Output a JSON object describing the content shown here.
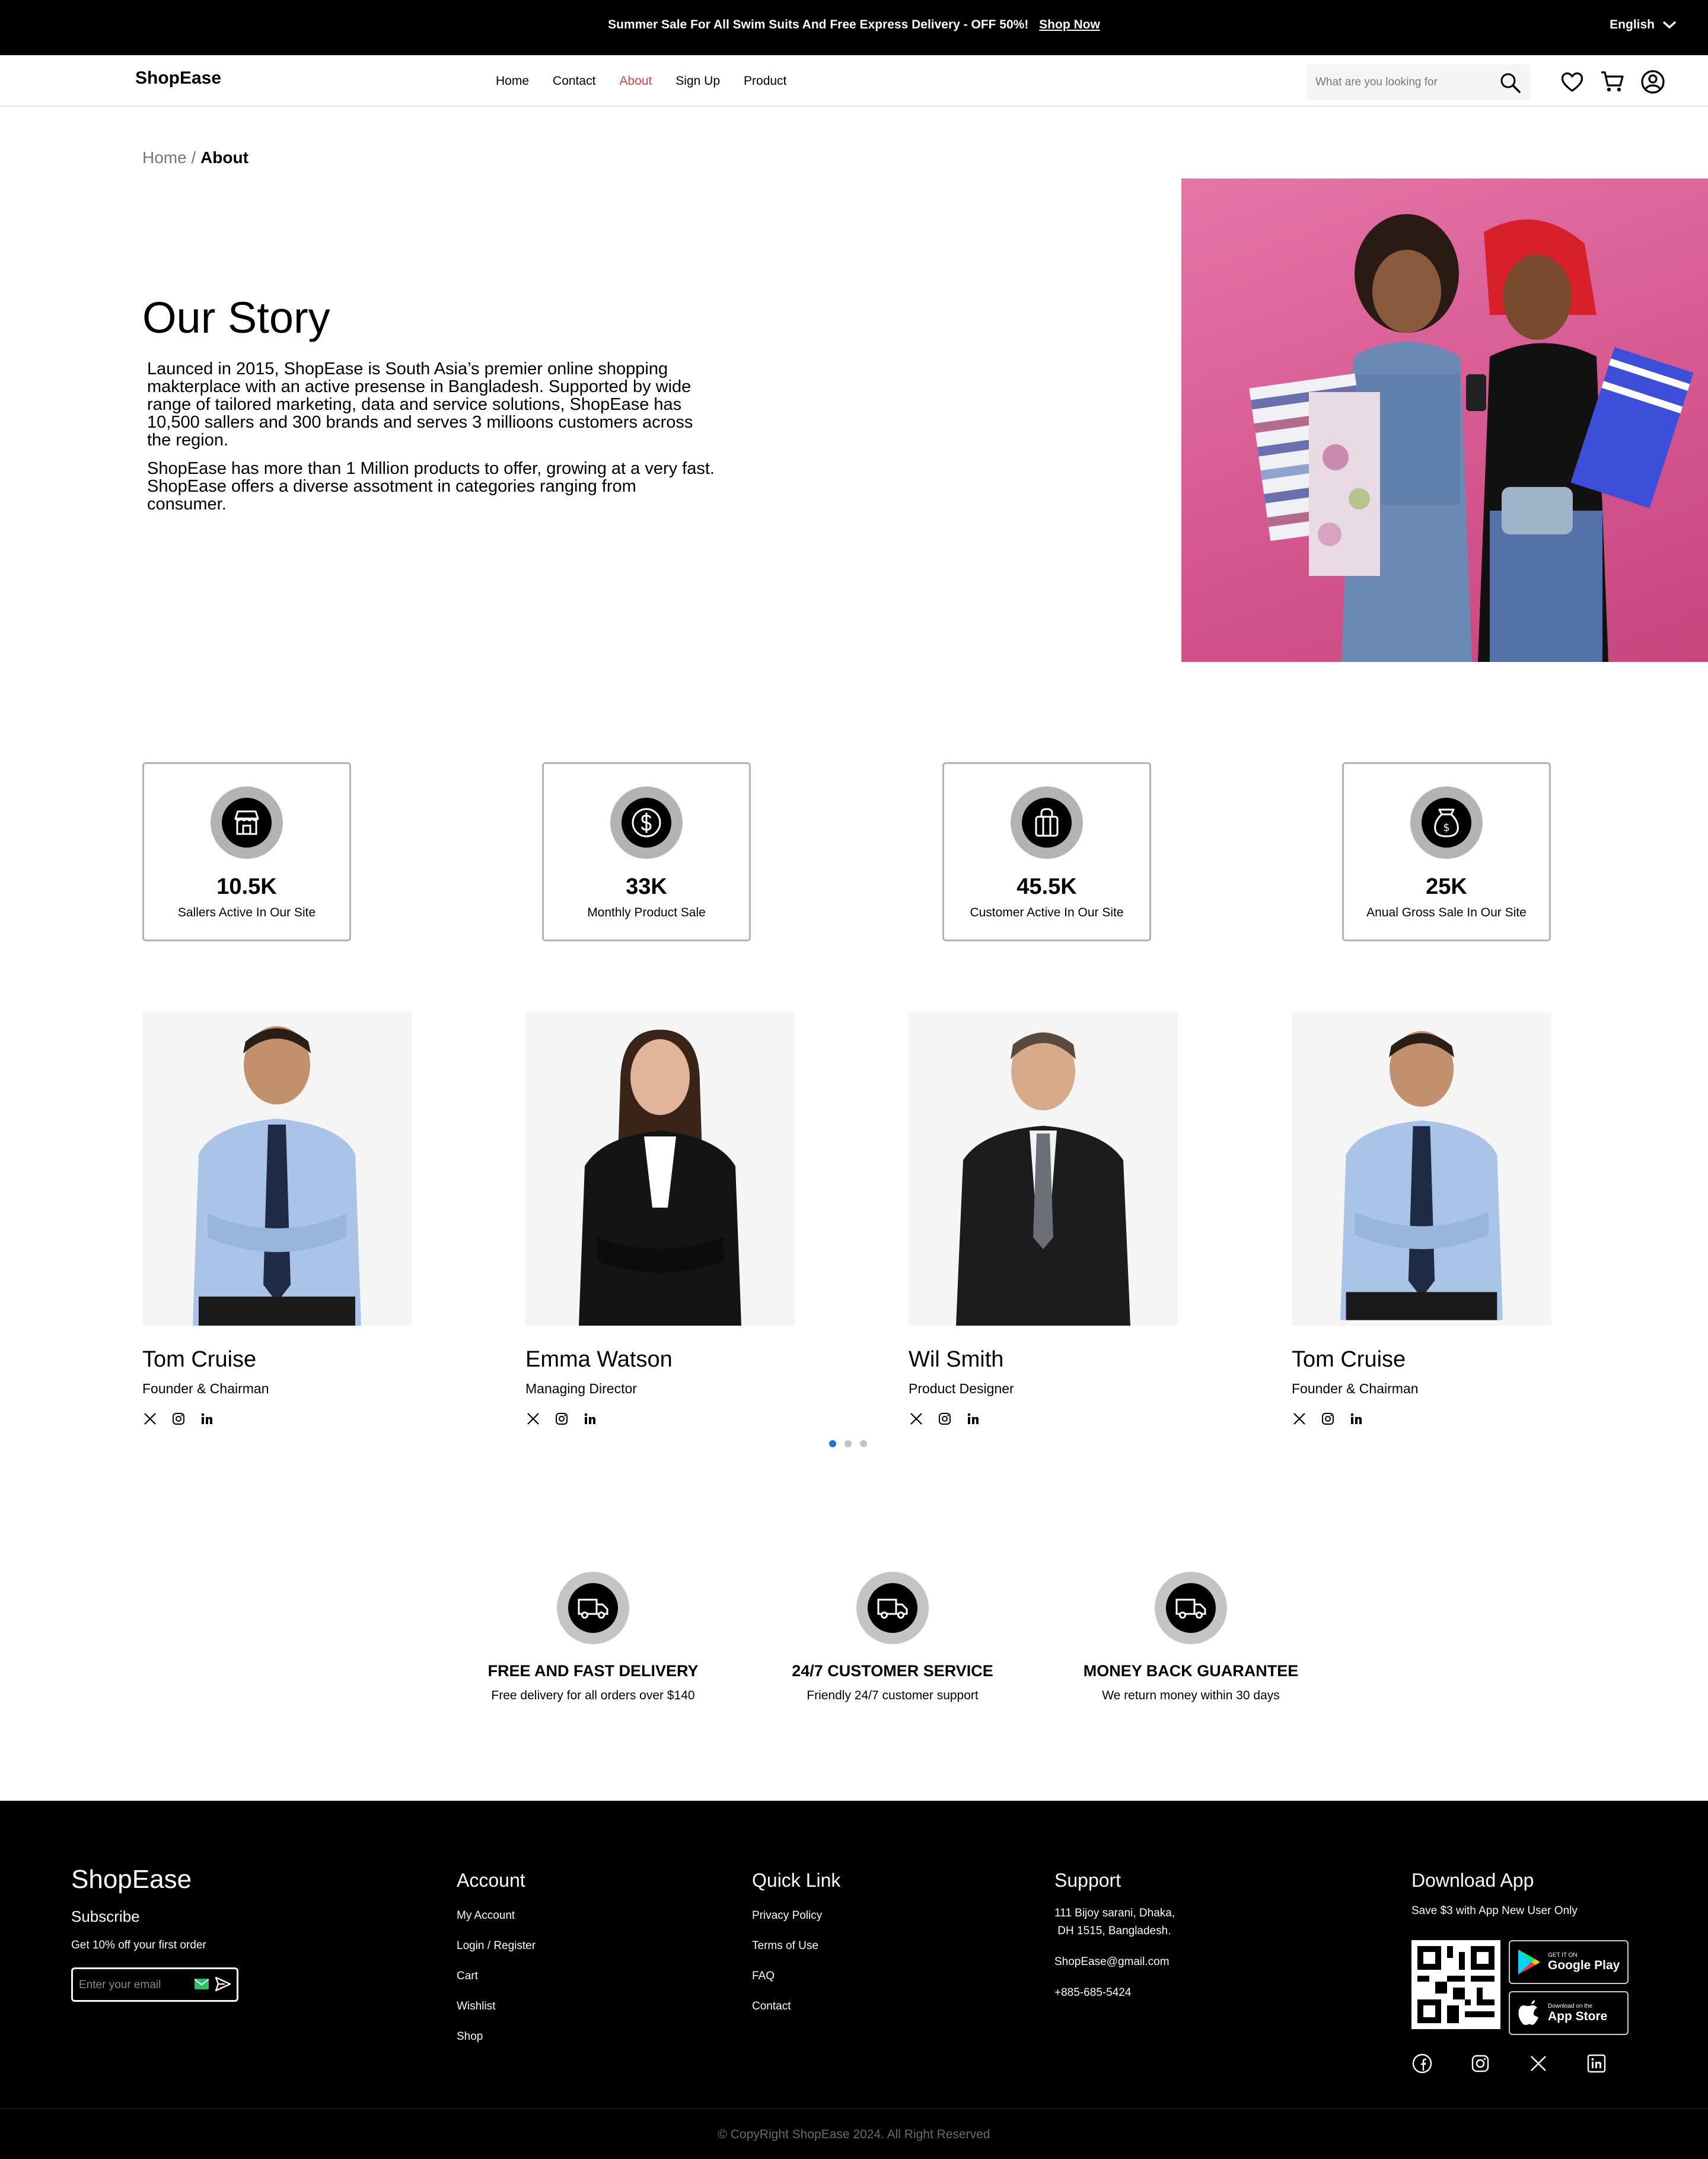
{
  "banner": {
    "message": "Summer Sale For All Swim Suits And Free Express Delivery - OFF 50%!",
    "cta": "Shop Now",
    "language": "English"
  },
  "header": {
    "logo": "ShopEase",
    "nav": [
      {
        "label": "Home",
        "active": false
      },
      {
        "label": "Contact",
        "active": false
      },
      {
        "label": "About",
        "active": true
      },
      {
        "label": "Sign Up",
        "active": false
      },
      {
        "label": "Product",
        "active": false
      }
    ],
    "search_placeholder": "What are you looking for",
    "accent": "#db4444"
  },
  "breadcrumb": {
    "parent": "Home",
    "separator": " / ",
    "current": "About"
  },
  "story": {
    "title": "Our Story",
    "p1": "Launced in 2015, ShopEase is South Asia’s premier online shopping makterplace with an active presense in Bangladesh. Supported by wide range of tailored marketing, data and service solutions, ShopEase has 10,500 sallers and 300 brands and serves 3 millioons customers across the region.",
    "p2": "ShopEase has more than 1 Million products to offer, growing at a very fast. ShopEase offers a diverse assotment in categories ranging from consumer."
  },
  "stats": [
    {
      "value": "10.5K",
      "label": "Sallers Active In Our Site",
      "icon": "shop-icon"
    },
    {
      "value": "33K",
      "label": "Monthly Product Sale",
      "icon": "dollar-icon"
    },
    {
      "value": "45.5K",
      "label": "Customer Active In Our Site",
      "icon": "gift-bag-icon"
    },
    {
      "value": "25K",
      "label": "Anual Gross Sale In Our Site",
      "icon": "money-bag-icon"
    }
  ],
  "team": [
    {
      "name": "Tom Cruise",
      "role": "Founder & Chairman"
    },
    {
      "name": "Emma Watson",
      "role": "Managing Director"
    },
    {
      "name": "Wil Smith",
      "role": "Product Designer"
    },
    {
      "name": "Tom Cruise",
      "role": "Founder & Chairman"
    }
  ],
  "carousel": {
    "pages": 3,
    "active": 0,
    "active_color": "#1a73e8"
  },
  "services": [
    {
      "title": "FREE AND FAST DELIVERY",
      "desc": "Free delivery for all orders over $140",
      "icon": "delivery-truck-icon"
    },
    {
      "title": "24/7 CUSTOMER SERVICE",
      "desc": "Friendly 24/7 customer support",
      "icon": "delivery-truck-icon"
    },
    {
      "title": "MONEY BACK GUARANTEE",
      "desc": "We return money within 30 days",
      "icon": "delivery-truck-icon"
    }
  ],
  "footer": {
    "brand": "ShopEase",
    "subscribe": "Subscribe",
    "offer": "Get 10% off your first order",
    "email_placeholder": "Enter your email",
    "account_title": "Account",
    "account_links": [
      "My Account",
      "Login / Register",
      "Cart",
      "Wishlist",
      "Shop"
    ],
    "quick_title": "Quick Link",
    "quick_links": [
      "Privacy Policy",
      "Terms of Use",
      "FAQ",
      "Contact"
    ],
    "support_title": "Support",
    "address_line1": "111 Bijoy sarani, Dhaka,",
    "address_line2": "DH 1515, Bangladesh.",
    "email": "ShopEase@gmail.com",
    "phone": "+885-685-5424",
    "app_title": "Download App",
    "app_offer": "Save $3 with App New User Only",
    "google_small": "GET IT ON",
    "google_big": "Google Play",
    "apple_small": "Download on the",
    "apple_big": "App Store",
    "copyright": "© CopyRight ShopEase 2024. All Right Reserved"
  }
}
